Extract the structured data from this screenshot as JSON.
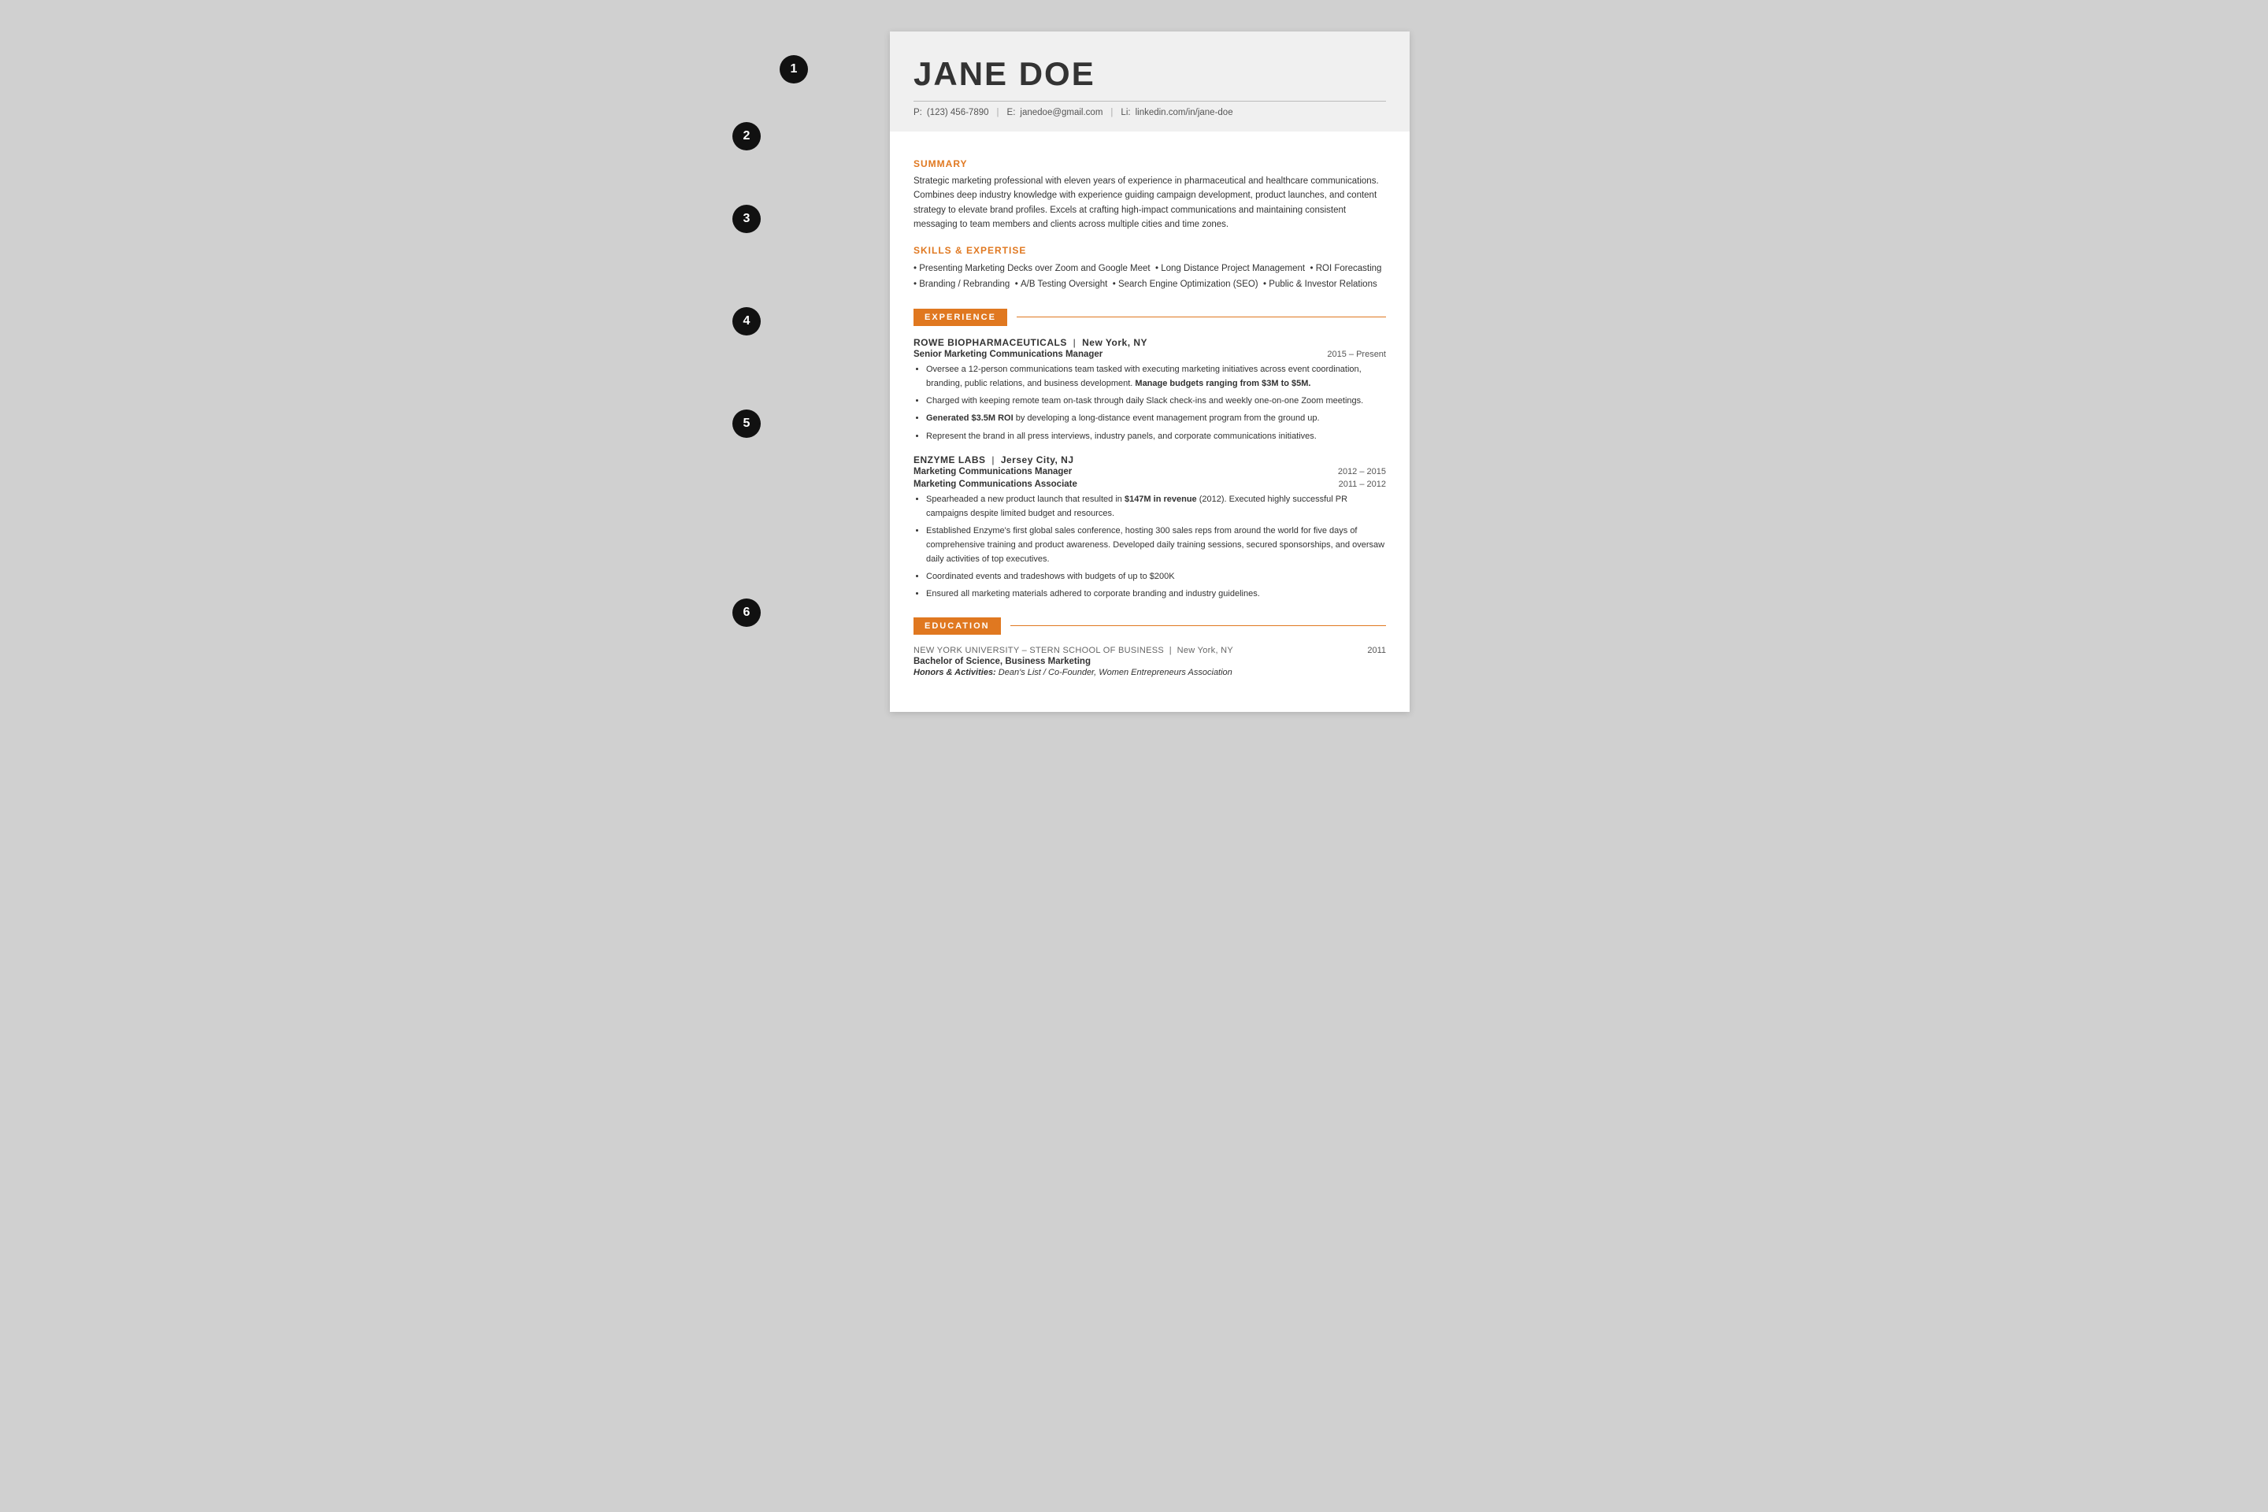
{
  "annotations": [
    {
      "id": 1,
      "label": "1"
    },
    {
      "id": 2,
      "label": "2"
    },
    {
      "id": 3,
      "label": "3"
    },
    {
      "id": 4,
      "label": "4"
    },
    {
      "id": 5,
      "label": "5"
    },
    {
      "id": 6,
      "label": "6"
    }
  ],
  "header": {
    "name": "JANE DOE",
    "phone_label": "P:",
    "phone": "(123) 456-7890",
    "email_label": "E:",
    "email": "janedoe@gmail.com",
    "linkedin_label": "Li:",
    "linkedin": "linkedin.com/in/jane-doe"
  },
  "summary": {
    "heading": "SUMMARY",
    "text": "Strategic marketing professional with eleven years of experience in pharmaceutical and healthcare communications. Combines deep industry knowledge with experience guiding campaign development, product launches, and content strategy to elevate brand profiles. Excels at crafting high-impact communications and maintaining consistent messaging to team members and clients across multiple cities and time zones."
  },
  "skills": {
    "heading": "SKILLS & EXPERTISE",
    "items": [
      "Presenting Marketing Decks over Zoom and Google Meet",
      "Long Distance Project Management",
      "ROI Forecasting",
      "Branding / Rebranding",
      "A/B Testing Oversight",
      "Search Engine Optimization (SEO)",
      "Public & Investor Relations"
    ]
  },
  "experience": {
    "section_label": "EXPERIENCE",
    "jobs": [
      {
        "company": "ROWE BIOPHARMACEUTICALS",
        "location": "New York, NY",
        "roles": [
          {
            "title": "Senior Marketing Communications Manager",
            "dates": "2015 – Present"
          }
        ],
        "bullets": [
          "Oversee a 12-person communications team tasked with executing marketing initiatives across event coordination, branding, public relations, and business development. Manage budgets ranging from $3M to $5M.",
          "Charged with keeping remote team on-task through daily Slack check-ins and weekly one-on-one Zoom meetings.",
          "Generated $3.5M ROI by developing a long-distance event management program from the ground up.",
          "Represent the brand in all press interviews, industry panels, and corporate communications initiatives."
        ],
        "bold_phrases": [
          "Manage budgets ranging from $3M to $5M.",
          "Generated $3.5M ROI"
        ]
      },
      {
        "company": "ENZYME LABS",
        "location": "Jersey City, NJ",
        "roles": [
          {
            "title": "Marketing Communications Manager",
            "dates": "2012 – 2015"
          },
          {
            "title": "Marketing Communications Associate",
            "dates": "2011 – 2012"
          }
        ],
        "bullets": [
          "Spearheaded a new product launch that resulted in $147M in revenue (2012). Executed highly successful PR campaigns despite limited budget and resources.",
          "Established Enzyme's first global sales conference, hosting 300 sales reps from around the world for five days of comprehensive training and product awareness. Developed daily training sessions, secured sponsorships, and oversaw daily activities of top executives.",
          "Coordinated events and tradeshows with budgets of up to $200K",
          "Ensured all marketing materials adhered to corporate branding and industry guidelines."
        ],
        "bold_phrases": [
          "$147M in revenue"
        ]
      }
    ]
  },
  "education": {
    "section_label": "EDUCATION",
    "entries": [
      {
        "school": "NEW YORK UNIVERSITY – STERN SCHOOL OF BUSINESS",
        "location": "New York, NY",
        "year": "2011",
        "degree": "Bachelor of Science, Business Marketing",
        "honors": "Honors & Activities: Dean's List / Co-Founder, Women Entrepreneurs Association"
      }
    ]
  }
}
